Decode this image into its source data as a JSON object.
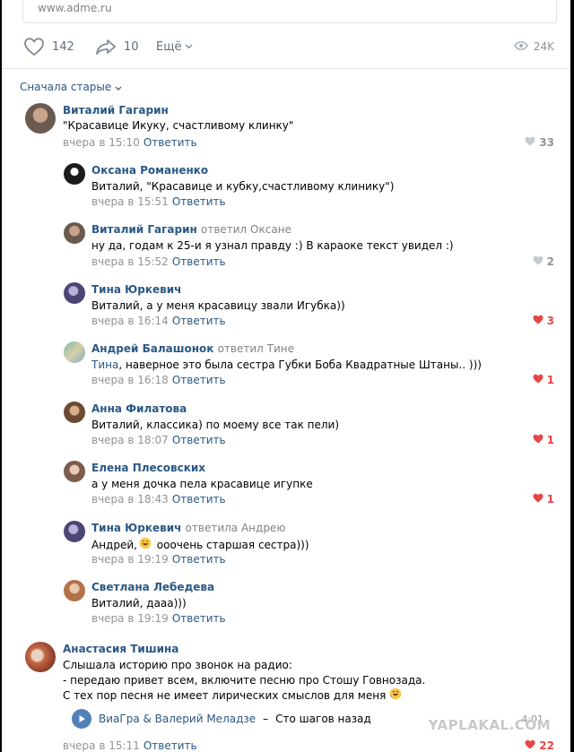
{
  "post": {
    "url": "www.adme.ru",
    "likes": "142",
    "shares": "10",
    "more": "Ещё",
    "views": "24K"
  },
  "sort": {
    "label": "Сначала старые"
  },
  "reply_label": "Ответить",
  "comments": [
    {
      "author": "Виталий Гагарин",
      "reply_to": "",
      "text": "\"Красавице Икуку, счастливому клинку\"",
      "time": "вчера в 15:10",
      "likes": "33",
      "liked": false
    },
    {
      "author": "Оксана Романенко",
      "reply_to": "",
      "text": "Виталий, \"Красавице и кубку,счастливому клинику\")",
      "time": "вчера в 15:51",
      "likes": "",
      "liked": false
    },
    {
      "author": "Виталий Гагарин",
      "reply_to": "ответил Оксане",
      "text": "ну да, годам к 25-и я узнал правду :) В караоке текст увидел :)",
      "time": "вчера в 15:52",
      "likes": "2",
      "liked": false
    },
    {
      "author": "Тина Юркевич",
      "reply_to": "",
      "text": "Виталий, а у меня красавицу звали Игубка))",
      "time": "вчера в 16:14",
      "likes": "3",
      "liked": true
    },
    {
      "author": "Андрей Балашонок",
      "reply_to": "ответил Тине",
      "mention": "Тина",
      "text": ", наверное это была сестра Губки Боба Квадратные Штаны.. )))",
      "time": "вчера в 16:18",
      "likes": "1",
      "liked": true
    },
    {
      "author": "Анна Филатова",
      "reply_to": "",
      "text": "Виталий, классика) по моему все так пели)",
      "time": "вчера в 18:07",
      "likes": "1",
      "liked": true
    },
    {
      "author": "Елена Плесовских",
      "reply_to": "",
      "text": "а у меня дочка пела красавице игупке",
      "time": "вчера в 18:43",
      "likes": "1",
      "liked": true
    },
    {
      "author": "Тина Юркевич",
      "reply_to": "ответила Андрею",
      "text_before": "Андрей, ",
      "text": " ооочень старшая сестра)))",
      "time": "вчера в 19:19",
      "likes": "",
      "liked": false
    },
    {
      "author": "Светлана Лебедева",
      "reply_to": "",
      "text": "Виталий, дааа)))",
      "time": "вчера в 19:19",
      "likes": "",
      "liked": false
    },
    {
      "author": "Анастасия Тишина",
      "reply_to": "",
      "lines": [
        "Слышала историю про звонок на радио:",
        "- передаю привет всем, включите песню про Стошу Говнозада.",
        "С тех пор песня не имеет лирических смыслов для меня"
      ],
      "time": "вчера в 15:11",
      "likes": "22",
      "liked": true
    }
  ],
  "audio": {
    "artist": "ВиаГра & Валерий Меладзе",
    "dash": "–",
    "title": "Сто шагов назад",
    "duration": "4:01"
  },
  "watermark": "YAPLAKAL.COM"
}
